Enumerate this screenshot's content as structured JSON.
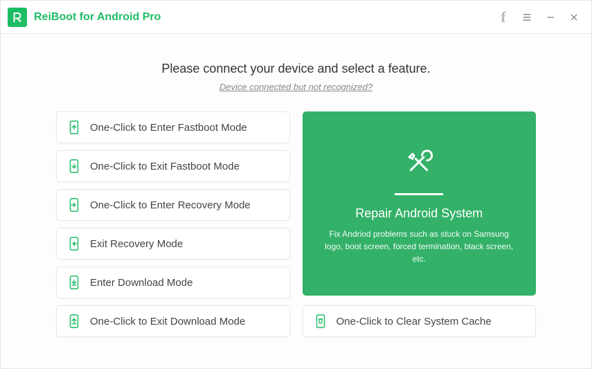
{
  "app": {
    "title": "ReiBoot for Android Pro",
    "accent_color": "#1fbc66"
  },
  "titlebar": {
    "facebook_icon": "f",
    "menu_icon": "menu-icon",
    "minimize_icon": "minimize-icon",
    "close_icon": "close-icon"
  },
  "main": {
    "headline": "Please connect your device and select a feature.",
    "sublink": "Device connected but not recognized?"
  },
  "features": [
    {
      "id": "enter-fastboot",
      "icon": "phone-arrow-up-icon",
      "label": "One-Click to Enter Fastboot Mode"
    },
    {
      "id": "exit-fastboot",
      "icon": "phone-arrow-down-icon",
      "label": "One-Click to Exit Fastboot Mode"
    },
    {
      "id": "enter-recovery",
      "icon": "phone-arrow-in-icon",
      "label": "One-Click to Enter Recovery Mode"
    },
    {
      "id": "exit-recovery",
      "icon": "phone-arrow-out-icon",
      "label": "Exit Recovery Mode"
    },
    {
      "id": "enter-download",
      "icon": "phone-download-icon",
      "label": "Enter Download Mode"
    },
    {
      "id": "exit-download",
      "icon": "phone-upload-icon",
      "label": "One-Click to Exit Download Mode"
    }
  ],
  "repair": {
    "title": "Repair Android System",
    "description": "Fix Andriod problems such as stuck on Samsung logo, boot screen, forced termination, black screen, etc.",
    "icon": "tools-icon"
  },
  "clear_cache": {
    "id": "clear-cache",
    "icon": "phone-trash-icon",
    "label": "One-Click to Clear System Cache"
  }
}
